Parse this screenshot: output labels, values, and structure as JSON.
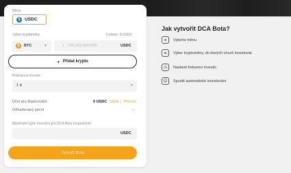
{
  "currency": {
    "label": "Měna",
    "selected": "USDC",
    "symbol": "$"
  },
  "crypto_select": {
    "label": "Výber kryptoměny",
    "total_label": "Celkem: 0 USDC",
    "coin": "BTC",
    "coin_symbol": "₿",
    "amount_placeholder": "1 - 720,323.5901025",
    "amount_unit": "USDC"
  },
  "add_crypto": {
    "label": "Přidat krypto",
    "icon": "plus-icon"
  },
  "frequency": {
    "label": "Frekvence investic",
    "value": "1 d"
  },
  "funding": {
    "account_label": "Účet pro financování",
    "account_value": "0 USDC",
    "deposit_link": "Vložit",
    "transfer_link": "Převod",
    "separator": "|",
    "estimated_label": "Odhadovaný počet",
    "estimated_value": "- -"
  },
  "max_amount": {
    "label": "Maximální výše investice pro DCA Bota (nepovinné)",
    "unit": "USDC"
  },
  "submit": {
    "label": "Vytvořit Bota"
  },
  "info": {
    "title": "Jak vytvořit DCA Bota?",
    "steps": [
      {
        "icon": "currency-icon",
        "glyph": "¤",
        "text": "Vyberte měnu"
      },
      {
        "icon": "sliders-icon",
        "glyph": "≡",
        "text": "Vyber kryptoměny, do kterých chceš investovat."
      },
      {
        "icon": "clock-icon",
        "glyph": "◷",
        "text": "Nastavit frekvenci investic"
      },
      {
        "icon": "robot-icon",
        "glyph": "☺",
        "text": "Spustit automatické investování"
      }
    ]
  },
  "colors": {
    "accent": "#f3a41b",
    "usdc": "#2775ca",
    "btc": "#f7931a",
    "link": "#f3a41b"
  }
}
